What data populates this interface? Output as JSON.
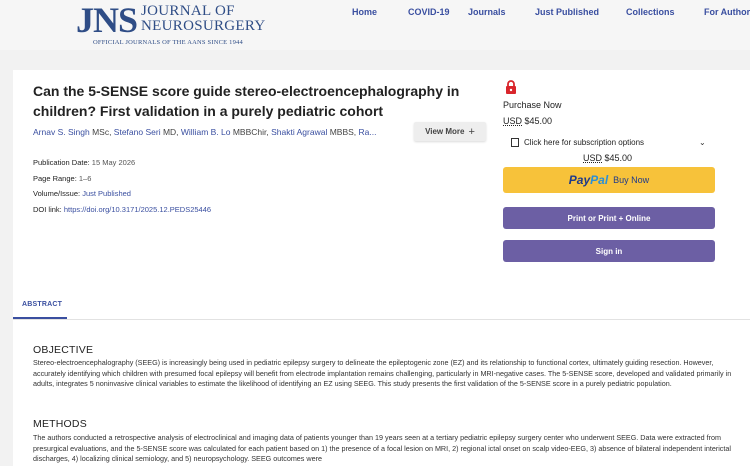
{
  "header": {
    "logo": {
      "jns": "JNS",
      "line1": "JOURNAL OF",
      "line2": "NEUROSURGERY",
      "sub": "OFFICIAL JOURNALS OF THE AANS SINCE 1944"
    },
    "nav": [
      "Home",
      "COVID-19",
      "Journals",
      "Just Published",
      "Collections",
      "For Authors"
    ]
  },
  "article": {
    "title": "Can the 5-SENSE score guide stereo-electroencephalography in children? First validation in a purely pediatric cohort",
    "authors": [
      {
        "name": "Arnav S. Singh",
        "degree": " MSc, "
      },
      {
        "name": "Stefano Seri",
        "degree": " MD, "
      },
      {
        "name": "William B. Lo",
        "degree": " MBBChir, "
      },
      {
        "name": "Shakti Agrawal",
        "degree": " MBBS, "
      },
      {
        "name": "Ra...",
        "degree": ""
      }
    ],
    "view_more": "View More",
    "meta": {
      "pub_date_label": "Publication Date:",
      "pub_date": "15 May 2026",
      "page_range_label": "Page Range:",
      "page_range": "1–6",
      "volume_label": "Volume/Issue:",
      "volume": "Just Published",
      "doi_label": "DOI link:",
      "doi": "https://doi.org/10.3171/2025.12.PEDS25446"
    }
  },
  "purchase": {
    "lock_icon": "lock-icon",
    "purchase_now": "Purchase Now",
    "usd": "USD",
    "price": "$45.00",
    "subscription_options": "Click here for subscription options",
    "paypal_pay": "Pay",
    "paypal_pal": "Pal",
    "paypal_buy": "Buy Now",
    "print_online": "Print or Print + Online",
    "sign_in": "Sign in"
  },
  "abstract": {
    "tab": "ABSTRACT",
    "objective_heading": "OBJECTIVE",
    "objective_text": "Stereo-electroencephalography (SEEG) is increasingly being used in pediatric epilepsy surgery to delineate the epileptogenic zone (EZ) and its relationship to functional cortex, ultimately guiding resection. However, accurately identifying which children with presumed focal epilepsy will benefit from electrode implantation remains challenging, particularly in MRI-negative cases. The 5-SENSE score, developed and validated primarily in adults, integrates 5 noninvasive clinical variables to estimate the likelihood of identifying an EZ using SEEG. This study presents the first validation of the 5-SENSE score in a purely pediatric population.",
    "methods_heading": "METHODS",
    "methods_text": "The authors conducted a retrospective analysis of electroclinical and imaging data of patients younger than 19 years seen at a tertiary pediatric epilepsy surgery center who underwent SEEG. Data were extracted from presurgical evaluations, and the 5-SENSE score was calculated for each patient based on 1) the presence of a focal lesion on MRI, 2) regional ictal onset on scalp video-EEG, 3) absence of bilateral independent interictal discharges, 4) localizing clinical semiology, and 5) neuropsychology. SEEG outcomes were"
  },
  "colors": {
    "brand": "#2f4d86",
    "link": "#3a4fa0",
    "paypal": "#f7c23a",
    "button": "#6c5fa4",
    "lock": "#d9262c"
  }
}
